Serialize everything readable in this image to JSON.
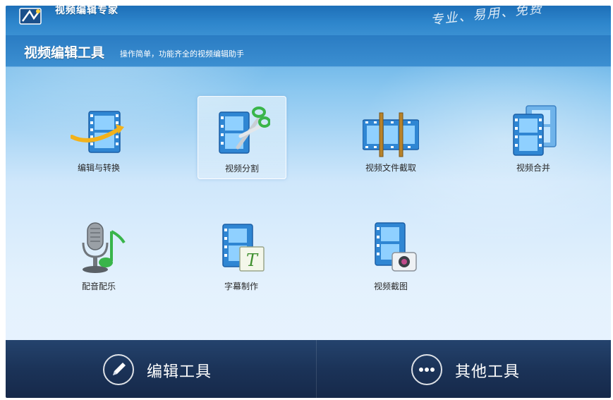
{
  "window": {
    "app_title": "视频编辑专家",
    "slogan": "专业、易用、免费"
  },
  "header": {
    "title": "视频编辑工具",
    "subtitle": "操作简单，功能齐全的视频编辑助手"
  },
  "tools": [
    {
      "label": "编辑与转换",
      "icon": "film-convert-icon",
      "selected": false
    },
    {
      "label": "视频分割",
      "icon": "film-scissors-icon",
      "selected": true
    },
    {
      "label": "视频文件截取",
      "icon": "film-cut-icon",
      "selected": false
    },
    {
      "label": "视频合并",
      "icon": "film-merge-icon",
      "selected": false
    },
    {
      "label": "配音配乐",
      "icon": "microphone-music-icon",
      "selected": false
    },
    {
      "label": "字幕制作",
      "icon": "film-subtitle-icon",
      "selected": false
    },
    {
      "label": "视频截图",
      "icon": "film-camera-icon",
      "selected": false
    }
  ],
  "bottom_nav": {
    "edit_tools": "编辑工具",
    "other_tools": "其他工具"
  },
  "colors": {
    "title_blue": "#2e86cc",
    "bottom_bar": "#1b3358",
    "film_blue": "#2f86d3"
  }
}
